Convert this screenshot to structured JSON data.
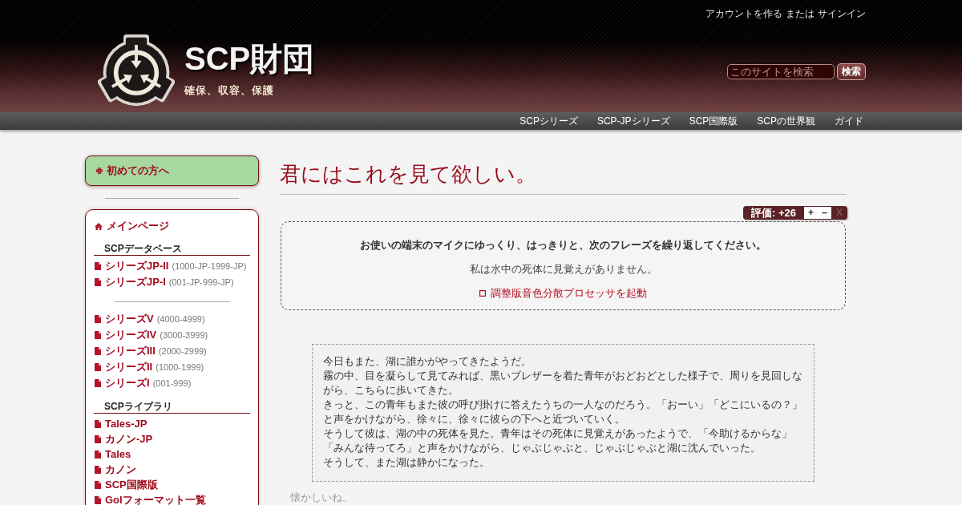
{
  "header": {
    "account": {
      "create_account": "アカウントを作る",
      "separator": "または",
      "sign_in": "サインイン"
    },
    "site_title": "SCP財団",
    "tagline": "確保、収容、保護",
    "search": {
      "placeholder": "このサイトを検索",
      "button": "検索"
    }
  },
  "top_nav": [
    "SCPシリーズ",
    "SCP-JPシリーズ",
    "SCP国際版",
    "SCPの世界観",
    "ガイド"
  ],
  "sidebar": {
    "intro_button": "初めての方へ",
    "menu": [
      {
        "kind": "home",
        "label": "メインページ"
      },
      {
        "kind": "heading",
        "label": "SCPデータベース"
      },
      {
        "kind": "page",
        "label": "シリーズJP-II",
        "range": "(1000-JP-1999-JP)"
      },
      {
        "kind": "page",
        "label": "シリーズJP-I",
        "range": "(001-JP-999-JP)"
      },
      {
        "kind": "divider"
      },
      {
        "kind": "page",
        "label": "シリーズV",
        "range": "(4000-4999)"
      },
      {
        "kind": "page",
        "label": "シリーズIV",
        "range": "(3000-3999)"
      },
      {
        "kind": "page",
        "label": "シリーズIII",
        "range": "(2000-2999)"
      },
      {
        "kind": "page",
        "label": "シリーズII",
        "range": "(1000-1999)"
      },
      {
        "kind": "page",
        "label": "シリーズI",
        "range": "(001-999)"
      },
      {
        "kind": "heading",
        "label": "SCPライブラリ"
      },
      {
        "kind": "page",
        "label": "Tales-JP"
      },
      {
        "kind": "page",
        "label": "カノン-JP"
      },
      {
        "kind": "page",
        "label": "Tales"
      },
      {
        "kind": "page",
        "label": "カノン"
      },
      {
        "kind": "page",
        "label": "SCP国際版"
      },
      {
        "kind": "page",
        "label": "GoIフォーマット一覧"
      }
    ]
  },
  "content": {
    "title": "君にはこれを見て欲しい。",
    "rating": {
      "score": "評価: +26",
      "buttons": [
        {
          "label": "+",
          "disabled": false
        },
        {
          "label": "–",
          "disabled": false
        },
        {
          "label": "X",
          "disabled": true
        }
      ]
    },
    "prompt": {
      "instruction": "お使いの端末のマイクにゆっくり、はっきりと、次のフレーズを繰り返してください。",
      "phrase": "私は水中の死体に見覚えがありません。",
      "link": "調整版音色分散プロセッサを起動"
    },
    "story": [
      "今日もまた、湖に誰かがやってきたようだ。",
      "霧の中、目を凝らして見てみれば、黒いブレザーを着た青年がおどおどとした様子で、周りを見回しながら、こちらに歩いてきた。",
      "きっと、この青年もまた彼の呼び掛けに答えたうちの一人なのだろう。「おーい」「どこにいるの？」と声をかけながら、徐々に、徐々に彼らの下へと近づいていく。",
      "そうして彼は、湖の中の死体を見た。青年はその死体に見覚えがあったようで、「今助けるからな」「みんな待ってろ」と声をかけながら、じゃぶじゃぶと、じゃぶじゃぶと湖に沈んでいった。",
      "そうして、また湖は静かになった。"
    ],
    "faint_text": "懐かしいね。"
  }
}
